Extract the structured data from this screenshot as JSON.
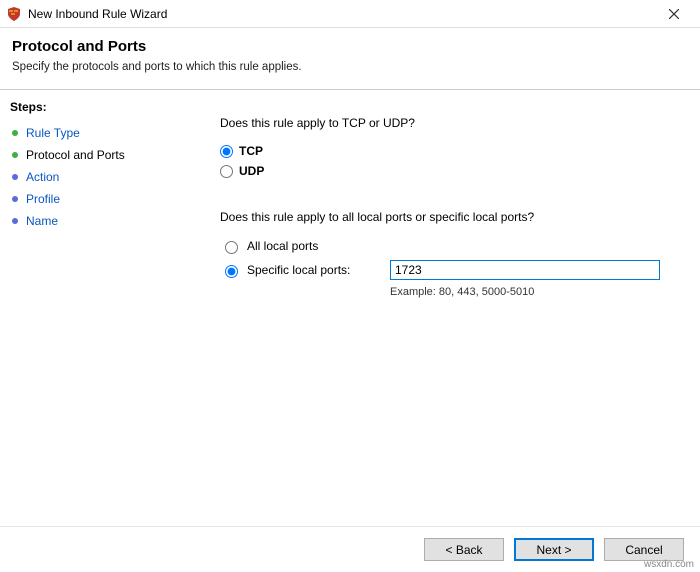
{
  "window": {
    "title": "New Inbound Rule Wizard"
  },
  "header": {
    "title": "Protocol and Ports",
    "subtitle": "Specify the protocols and ports to which this rule applies."
  },
  "sidebar": {
    "heading": "Steps:",
    "items": [
      {
        "label": "Rule Type",
        "state": "done"
      },
      {
        "label": "Protocol and Ports",
        "state": "current"
      },
      {
        "label": "Action",
        "state": "pending"
      },
      {
        "label": "Profile",
        "state": "pending"
      },
      {
        "label": "Name",
        "state": "pending"
      }
    ]
  },
  "main": {
    "protocol_question": "Does this rule apply to TCP or UDP?",
    "tcp_label": "TCP",
    "udp_label": "UDP",
    "protocol_selected": "tcp",
    "ports_question": "Does this rule apply to all local ports or specific local ports?",
    "all_ports_label": "All local ports",
    "specific_ports_label": "Specific local ports:",
    "ports_selected": "specific",
    "port_value": "1723",
    "port_example": "Example: 80, 443, 5000-5010"
  },
  "footer": {
    "back": "< Back",
    "next": "Next >",
    "cancel": "Cancel"
  },
  "watermark": "wsxdn.com"
}
